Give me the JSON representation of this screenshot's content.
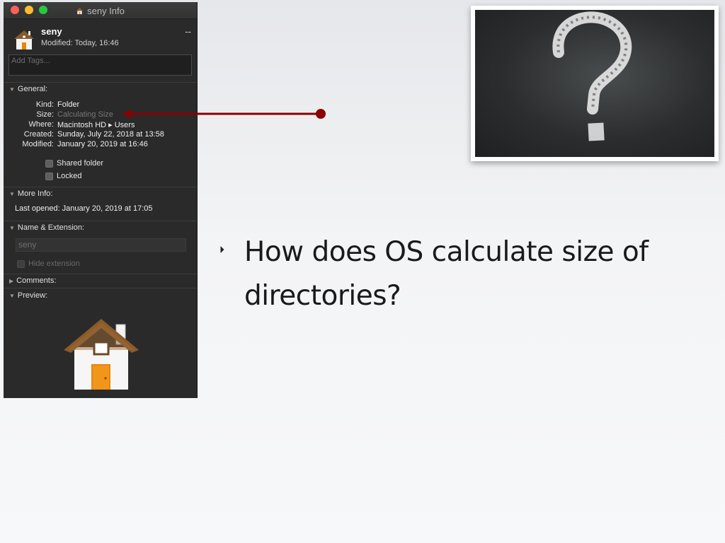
{
  "window": {
    "title": "seny Info",
    "name": "seny",
    "modified_header": "Modified: Today, 16:46",
    "dash": "--",
    "tags_placeholder": "Add Tags..."
  },
  "general": {
    "title": "General:",
    "rows": [
      {
        "key": "Kind:",
        "value": "Folder"
      },
      {
        "key": "Size:",
        "value": "Calculating Size"
      },
      {
        "key": "Where:",
        "value": "Macintosh HD ▸ Users"
      },
      {
        "key": "Created:",
        "value": "Sunday, July 22, 2018 at 13:58"
      },
      {
        "key": "Modified:",
        "value": "January 20, 2019 at 16:46"
      }
    ],
    "shared_folder": "Shared folder",
    "locked": "Locked"
  },
  "more_info": {
    "title": "More Info:",
    "last_opened": "Last opened: January 20, 2019 at 17:05"
  },
  "name_extension": {
    "title": "Name & Extension:",
    "name_value": "seny",
    "hide_extension": "Hide extension"
  },
  "comments": {
    "title": "Comments:"
  },
  "preview": {
    "title": "Preview:"
  },
  "slide": {
    "bullet": "How does OS calculate size of directories?"
  },
  "colors": {
    "arrow": "#8b0000",
    "door": "#e8860c",
    "roof": "#8a5a2b"
  }
}
